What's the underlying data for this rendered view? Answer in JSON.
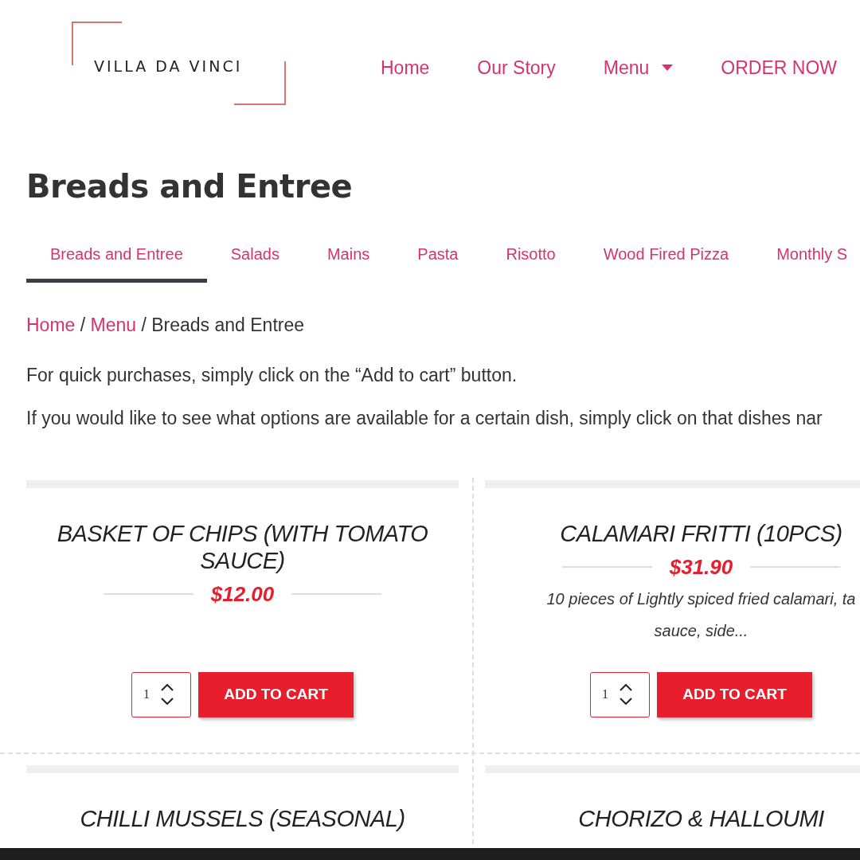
{
  "logo": {
    "text": "VILLA DA VINCI"
  },
  "nav": [
    {
      "label": "Home",
      "dropdown": false
    },
    {
      "label": "Our Story",
      "dropdown": false
    },
    {
      "label": "Menu",
      "dropdown": true
    },
    {
      "label": "ORDER NOW",
      "dropdown": false
    }
  ],
  "heading": "Breads and Entree",
  "tabs": [
    {
      "label": "Breads and Entree",
      "selected": true
    },
    {
      "label": "Salads",
      "selected": false
    },
    {
      "label": "Mains",
      "selected": false
    },
    {
      "label": "Pasta",
      "selected": false
    },
    {
      "label": "Risotto",
      "selected": false
    },
    {
      "label": "Wood Fired Pizza",
      "selected": false
    },
    {
      "label": "Monthly S",
      "selected": false
    }
  ],
  "breadcrumb": {
    "links": [
      "Home",
      "Menu"
    ],
    "separator": "/",
    "current": "Breads and Entree"
  },
  "intro": [
    "For quick purchases, simply click on the “Add to cart” button.",
    "If you would like to see what options are available for a certain dish, simply click on that dishes nar"
  ],
  "products": [
    {
      "name": "BASKET OF CHIPS (WITH TOMATO SAUCE)",
      "price": "$12.00",
      "quantity": "1",
      "button": "ADD TO CART"
    },
    {
      "name": "CALAMARI FRITTI (10PCS)",
      "price": "$31.90",
      "description": [
        "10 pieces of Lightly spiced fried calamari, ta",
        "sauce, side..."
      ],
      "quantity": "1",
      "button": "ADD TO CART"
    },
    {
      "name": "CHILLI MUSSELS (SEASONAL)"
    },
    {
      "name": "CHORIZO & HALLOUMI"
    }
  ]
}
